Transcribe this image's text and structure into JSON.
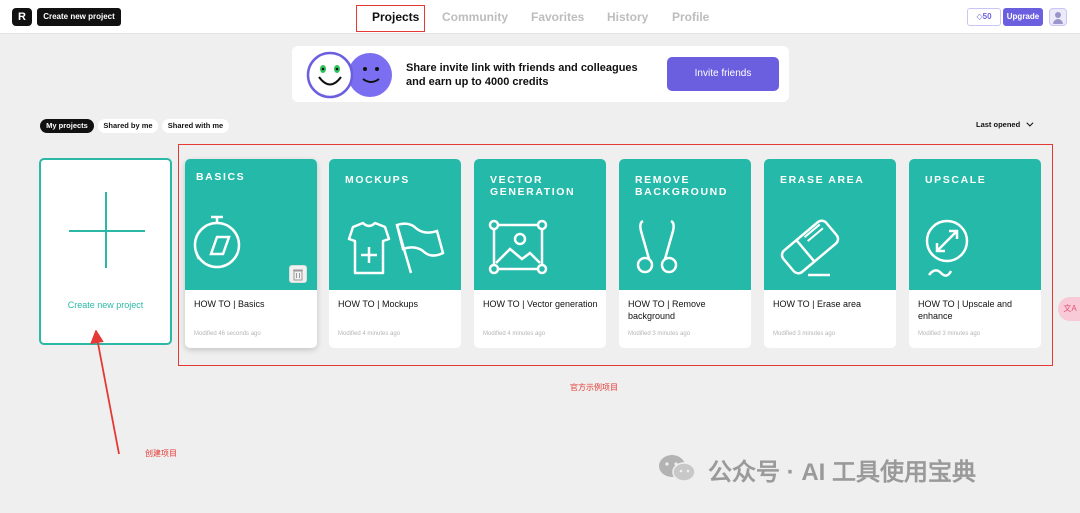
{
  "topbar": {
    "logo": "R",
    "create_button": "Create new project",
    "nav": [
      "Projects",
      "Community",
      "Favorites",
      "History",
      "Profile"
    ],
    "credits": "50",
    "upgrade": "Upgrade"
  },
  "banner": {
    "text": "Share invite link with friends and colleagues and earn up to 4000 credits",
    "button": "Invite friends"
  },
  "filters": {
    "tabs": [
      "My projects",
      "Shared by me",
      "Shared with me"
    ],
    "sort": "Last opened"
  },
  "new_project": {
    "label": "Create new project"
  },
  "cards": [
    {
      "category": "BASICS",
      "title": "HOW TO | Basics",
      "modified": "Modified 46 seconds ago"
    },
    {
      "category": "MOCKUPS",
      "title": "HOW TO | Mockups",
      "modified": "Modified 4 minutes ago"
    },
    {
      "category": "VECTOR GENERATION",
      "title": "HOW TO | Vector generation",
      "modified": "Modified 4 minutes ago"
    },
    {
      "category": "REMOVE BACKGROUND",
      "title": "HOW TO | Remove background",
      "modified": "Modified 3 minutes ago"
    },
    {
      "category": "ERASE AREA",
      "title": "HOW TO | Erase area",
      "modified": "Modified 3 minutes ago"
    },
    {
      "category": "UPSCALE",
      "title": "HOW TO | Upscale and enhance",
      "modified": "Modified 3 minutes ago"
    }
  ],
  "annotations": {
    "examples": "官方示例项目",
    "create": "创建项目"
  },
  "side_tab": "文A",
  "watermark": "公众号 · AI 工具使用宝典",
  "colors": {
    "accent": "#6b5fe0",
    "teal": "#24b9a8",
    "annotation": "#e53935"
  }
}
